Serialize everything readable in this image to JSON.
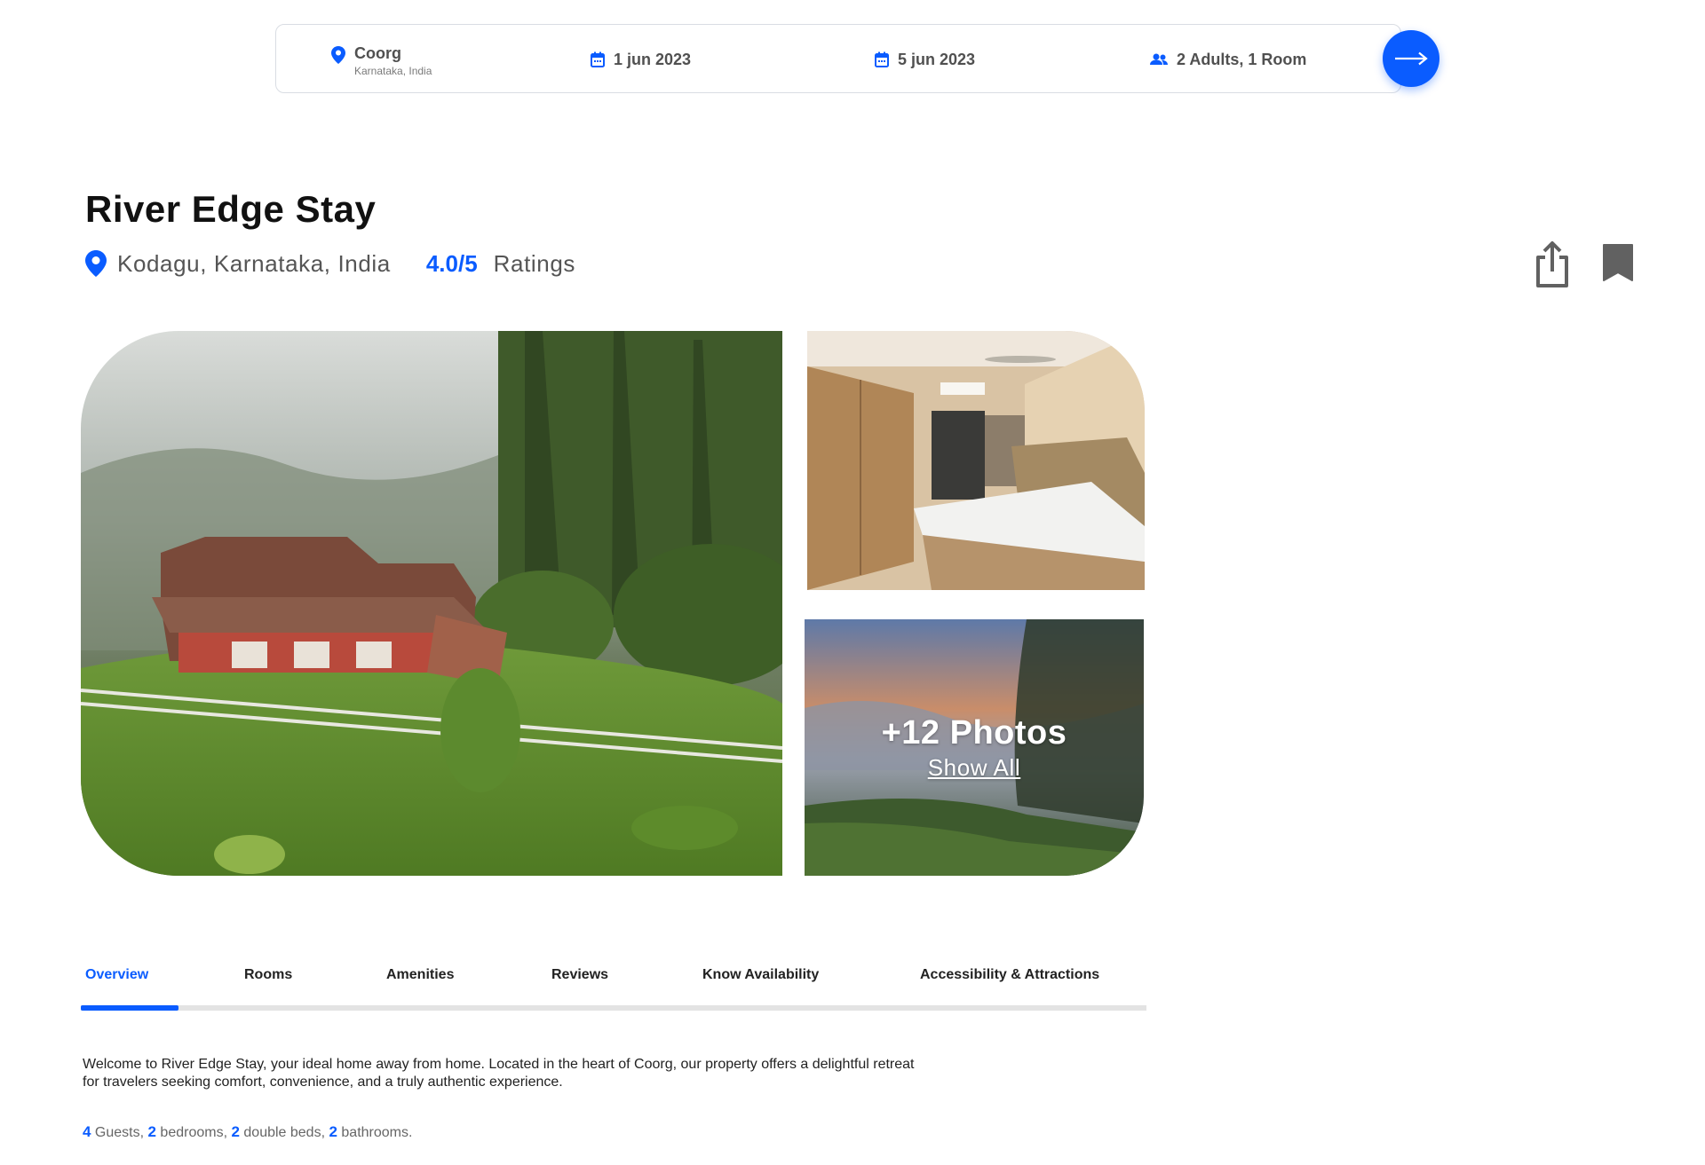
{
  "search": {
    "location": "Coorg",
    "location_sub": "Karnataka, India",
    "check_in": "1 jun 2023",
    "check_out": "5 jun 2023",
    "guests": "2 Adults, 1 Room",
    "icons": {
      "location": "location-pin-icon",
      "date": "calendar-icon",
      "guests": "people-icon",
      "go": "arrow-right-icon"
    }
  },
  "property": {
    "name": "River Edge Stay",
    "location": "Kodagu, Karnataka, India",
    "rating": "4.0/5",
    "rating_label": "Ratings"
  },
  "actions": {
    "share_icon": "share-icon",
    "bookmark_icon": "bookmark-icon"
  },
  "gallery": {
    "main_photo": "hillside-cottage-photo",
    "side_photo": "bedroom-photo",
    "more_photo": "sunset-hills-photo",
    "more_count": "+12 Photos",
    "show_all": "Show All"
  },
  "tabs": [
    {
      "label": "Overview",
      "active": true
    },
    {
      "label": "Rooms",
      "active": false
    },
    {
      "label": "Amenities",
      "active": false
    },
    {
      "label": "Reviews",
      "active": false
    },
    {
      "label": "Know Availability",
      "active": false
    },
    {
      "label": "Accessibility & Attractions",
      "active": false
    }
  ],
  "overview": {
    "description_line1": "Welcome to River Edge Stay, your ideal home away from home. Located in the heart of Coorg, our property offers a delightful retreat",
    "description_line2": "for travelers seeking comfort, convenience, and a truly authentic experience.",
    "facts": [
      {
        "num": "4",
        "label": "Guests",
        "sep": ", "
      },
      {
        "num": "2",
        "label": "bedrooms",
        "sep": ", "
      },
      {
        "num": "2",
        "label": "double beds",
        "sep": ", "
      },
      {
        "num": "2",
        "label": "bathrooms",
        "sep": "."
      }
    ]
  },
  "colors": {
    "accent": "#0a5cff",
    "text_dark": "#111111",
    "text_muted": "#555555",
    "tab_track": "#e3e3e3"
  }
}
